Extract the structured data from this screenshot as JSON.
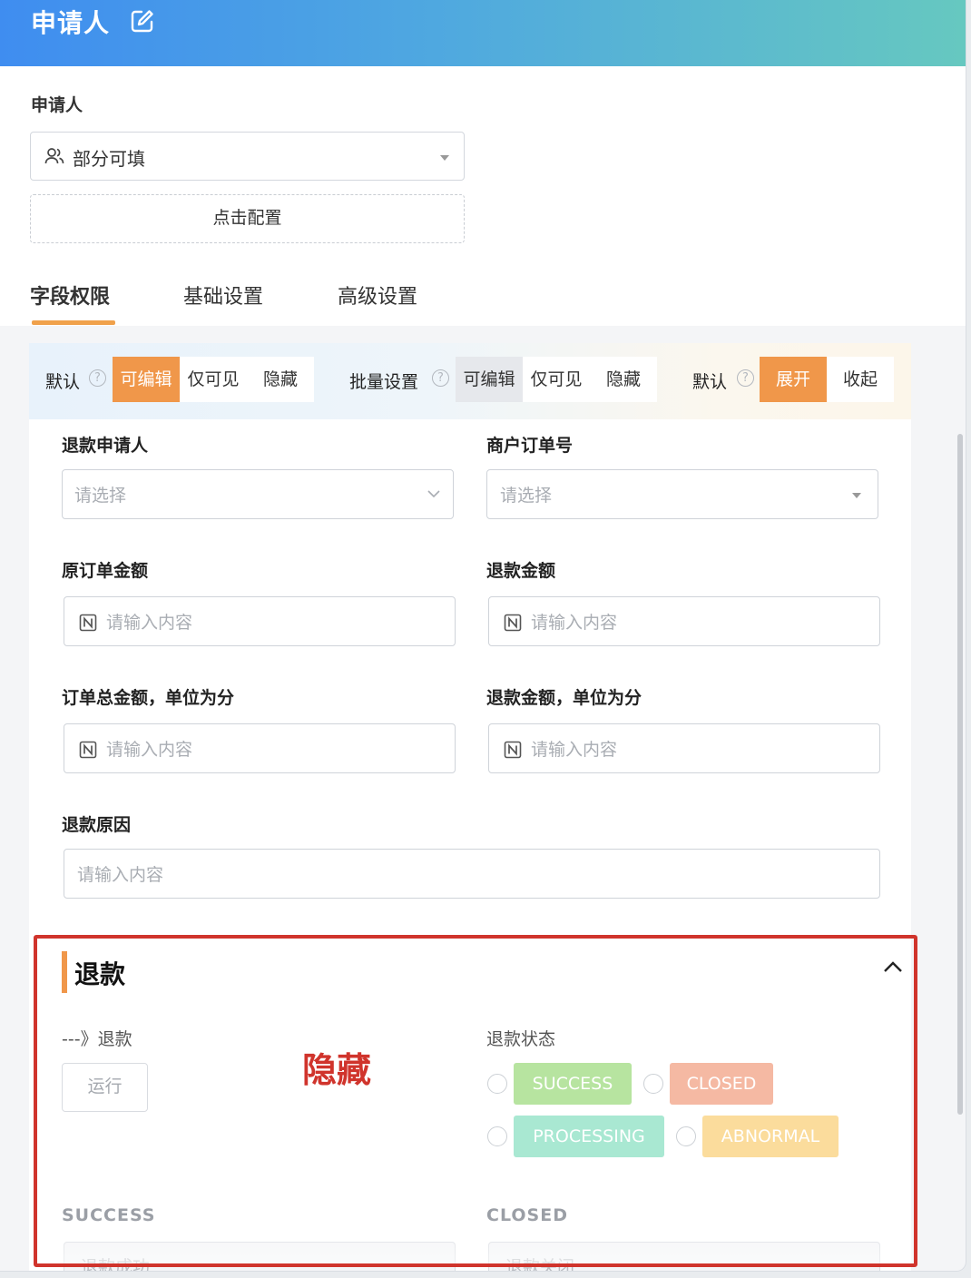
{
  "header": {
    "title": "申请人",
    "edit_icon": "edit-icon"
  },
  "applicant": {
    "label": "申请人",
    "permission_value": "部分可填",
    "config_button": "点击配置"
  },
  "tabs": [
    {
      "label": "字段权限",
      "active": true
    },
    {
      "label": "基础设置",
      "active": false
    },
    {
      "label": "高级设置",
      "active": false
    }
  ],
  "toolbar": {
    "default_label": "默认",
    "default_options": [
      "可编辑",
      "仅可见",
      "隐藏"
    ],
    "default_selected": "可编辑",
    "batch_label": "批量设置",
    "batch_options": [
      "可编辑",
      "仅可见",
      "隐藏"
    ],
    "expand_label": "默认",
    "expand_options": [
      "展开",
      "收起"
    ],
    "expand_selected": "展开"
  },
  "fields": {
    "refund_applicant": {
      "label": "退款申请人",
      "placeholder": "请选择"
    },
    "merchant_order_no": {
      "label": "商户订单号",
      "placeholder": "请选择"
    },
    "original_amount": {
      "label": "原订单金额",
      "placeholder": "请输入内容"
    },
    "refund_amount": {
      "label": "退款金额",
      "placeholder": "请输入内容"
    },
    "order_total_cents": {
      "label": "订单总金额，单位为分",
      "placeholder": "请输入内容"
    },
    "refund_amount_cents": {
      "label": "退款金额，单位为分",
      "placeholder": "请输入内容"
    },
    "refund_reason": {
      "label": "退款原因",
      "placeholder": "请输入内容"
    }
  },
  "refund_section": {
    "title": "退款",
    "flow_label": "---》退款",
    "run_button": "运行",
    "annotation": "隐藏",
    "status_label": "退款状态",
    "statuses": [
      {
        "label": "SUCCESS",
        "color": "#b7e4a0"
      },
      {
        "label": "CLOSED",
        "color": "#f5b9a3"
      },
      {
        "label": "PROCESSING",
        "color": "#a9e8d2"
      },
      {
        "label": "ABNORMAL",
        "color": "#fbdc9c"
      }
    ],
    "success_label": "SUCCESS",
    "success_placeholder": "退款成功",
    "closed_label": "CLOSED",
    "closed_placeholder": "退款关闭"
  },
  "colors": {
    "accent": "#f0974a",
    "annotation": "#d0342c"
  }
}
